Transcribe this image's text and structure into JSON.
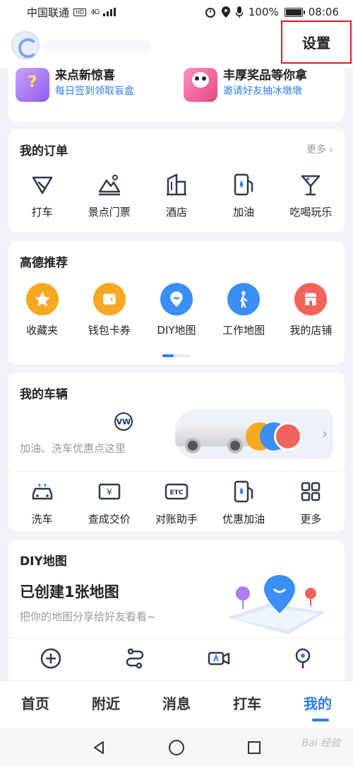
{
  "status": {
    "carrier": "中国联通",
    "network": "4G",
    "battery": "100%",
    "time": "08:06"
  },
  "header": {
    "settings_label": "设置"
  },
  "promo": {
    "left_title": "来点新惊喜",
    "left_sub": "每日签到领取盲盒",
    "right_title": "丰厚奖品等你拿",
    "right_sub": "邀请好友抽冰墩墩"
  },
  "orders": {
    "title": "我的订单",
    "more": "更多",
    "items": [
      {
        "label": "打车",
        "icon": "taxi-icon"
      },
      {
        "label": "景点门票",
        "icon": "scenic-ticket-icon"
      },
      {
        "label": "酒店",
        "icon": "hotel-icon"
      },
      {
        "label": "加油",
        "icon": "fuel-icon"
      },
      {
        "label": "吃喝玩乐",
        "icon": "cocktail-icon"
      }
    ]
  },
  "recommend": {
    "title": "高德推荐",
    "items": [
      {
        "label": "收藏夹",
        "icon": "star-icon",
        "color": "#f7a823"
      },
      {
        "label": "钱包卡券",
        "icon": "wallet-icon",
        "color": "#f7a823"
      },
      {
        "label": "DIY地图",
        "icon": "diy-map-icon",
        "color": "#3a8ef6"
      },
      {
        "label": "工作地图",
        "icon": "walker-icon",
        "color": "#3a8ef6"
      },
      {
        "label": "我的店铺",
        "icon": "shop-icon",
        "color": "#f2645b"
      }
    ]
  },
  "vehicle": {
    "title": "我的车辆",
    "brand": "VW",
    "desc": "加油、洗车优惠点这里",
    "items": [
      {
        "label": "洗车",
        "icon": "car-wash-icon"
      },
      {
        "label": "查成交价",
        "icon": "price-tag-icon"
      },
      {
        "label": "对账助手",
        "icon": "etc-icon"
      },
      {
        "label": "优惠加油",
        "icon": "fuel-discount-icon"
      },
      {
        "label": "更多",
        "icon": "grid-more-icon"
      }
    ]
  },
  "diy": {
    "title": "DIY地图",
    "big": "已创建1张地图",
    "sub": "把你的地图分享给好友看看~"
  },
  "nav": {
    "tabs": [
      "首页",
      "附近",
      "消息",
      "打车",
      "我的"
    ],
    "active": 4
  },
  "watermark": "Bai 经验",
  "colors": {
    "accent": "#2e7ef0",
    "highlight_border": "#d81e1e"
  }
}
